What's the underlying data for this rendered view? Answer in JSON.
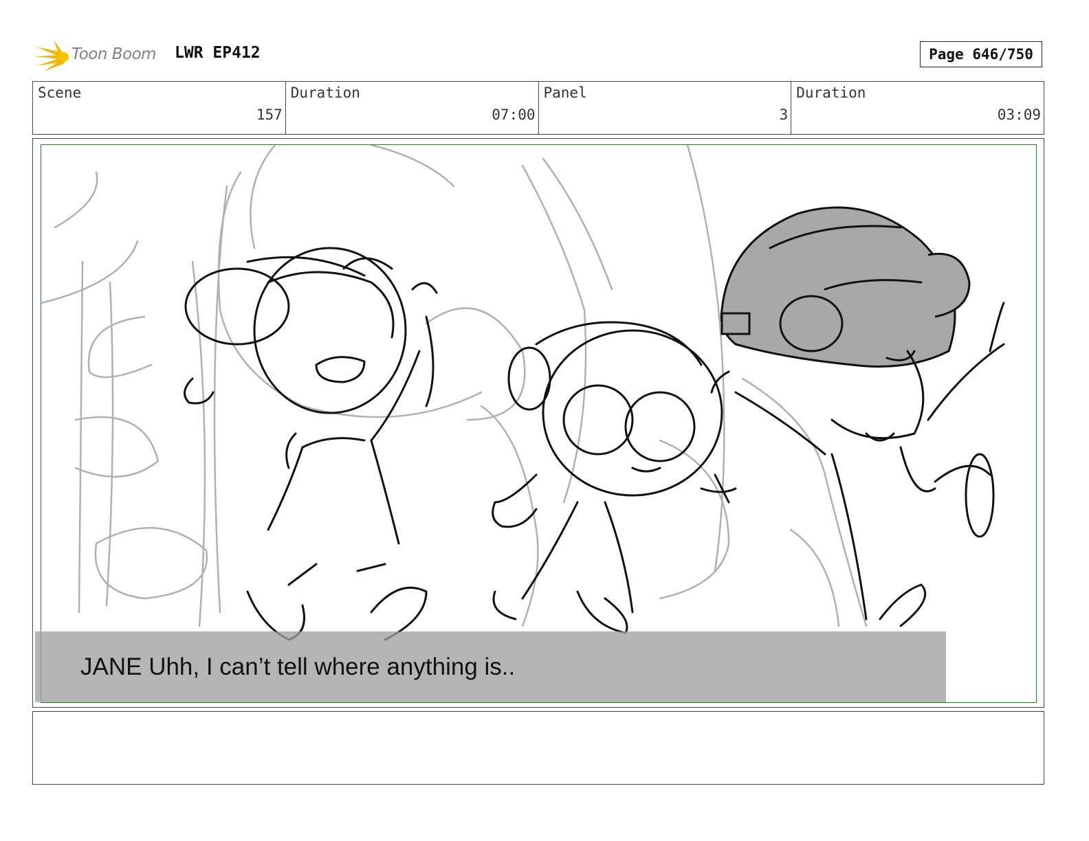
{
  "header": {
    "brand": "Toon Boom",
    "episode": "LWR EP412",
    "page": "Page 646/750"
  },
  "info": {
    "scene_label": "Scene",
    "scene_value": "157",
    "duration_label": "Duration",
    "duration_value": "07:00",
    "panel_label": "Panel",
    "panel_value": "3",
    "panel_duration_label": "Duration",
    "panel_duration_value": "03:09"
  },
  "panel": {
    "dialogue": "JANE Uhh, I can’t tell where anything is..",
    "frame_color": "#2e7d32"
  },
  "notes": {
    "text": ""
  }
}
